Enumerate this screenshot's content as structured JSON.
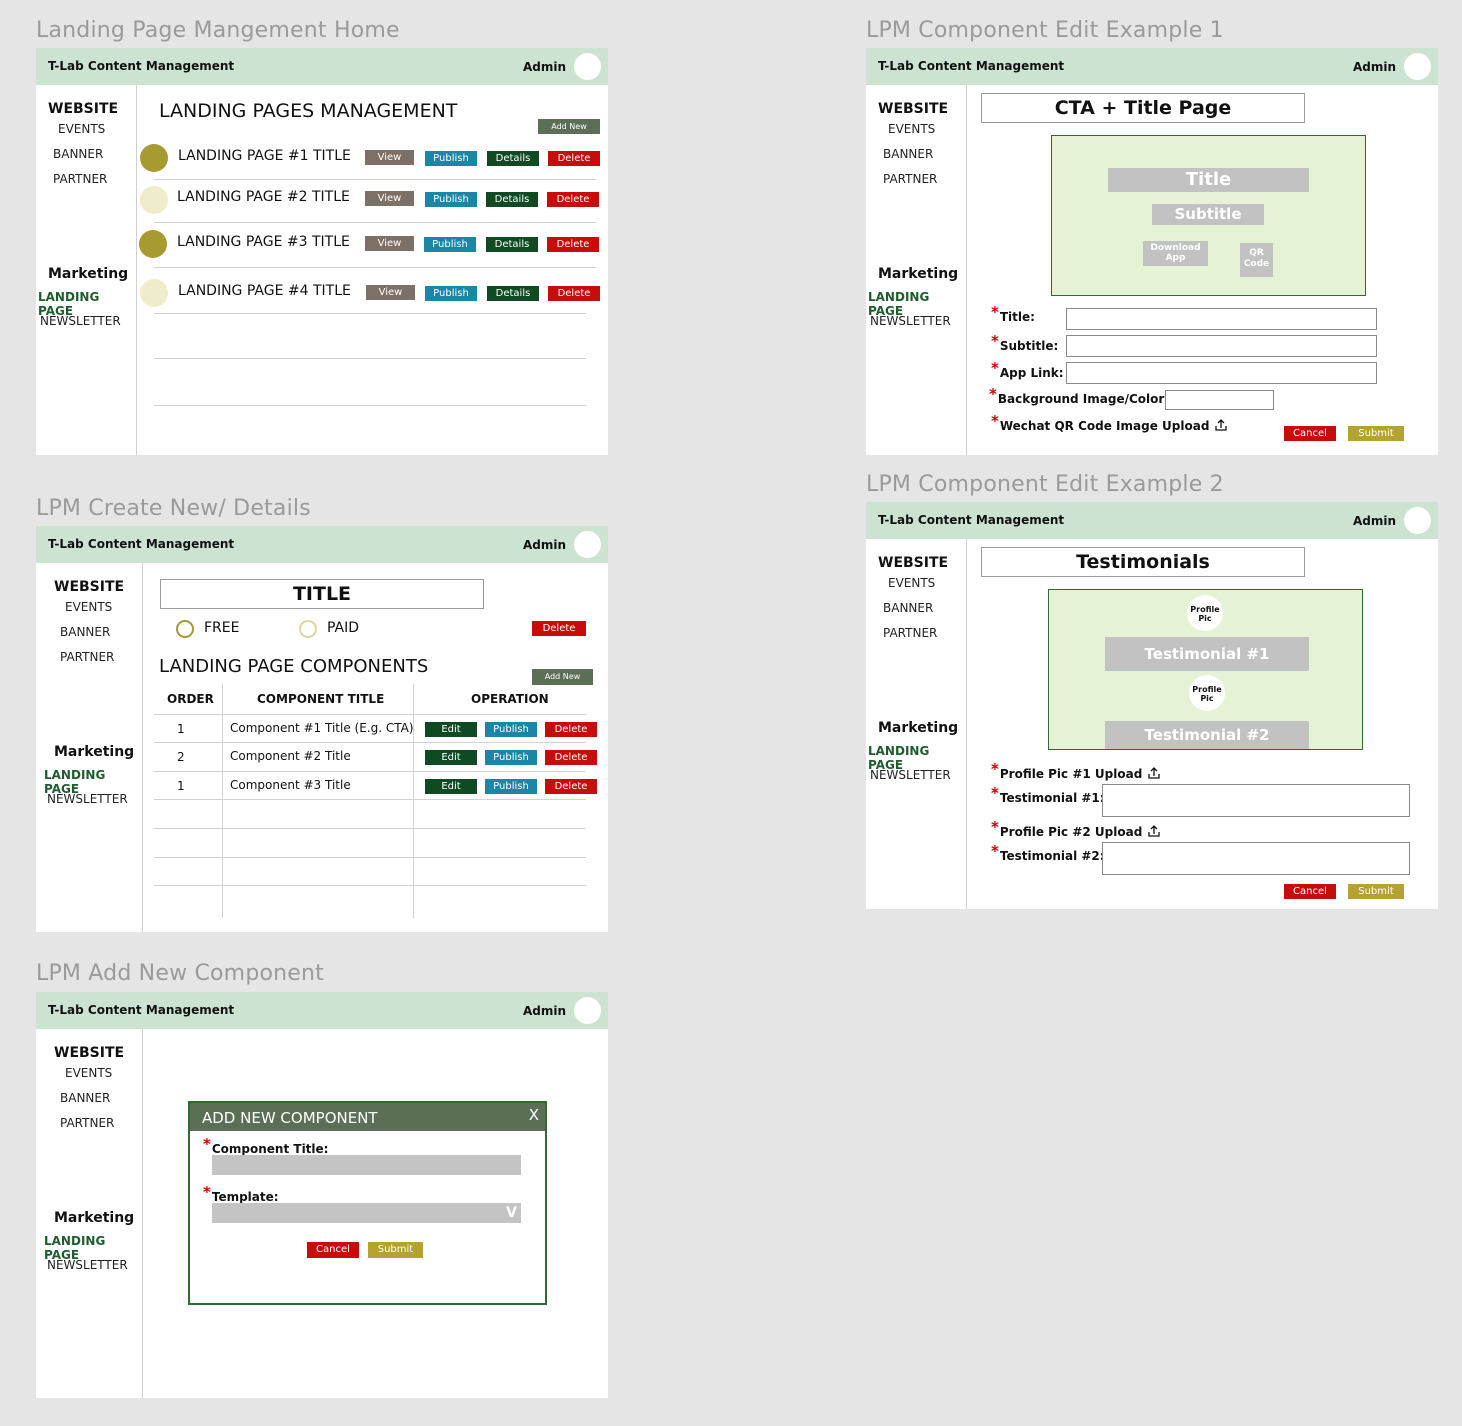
{
  "app": {
    "title": "T-Lab Content Management",
    "admin": "Admin"
  },
  "sidebar": {
    "website": "WEBSITE",
    "events": "EVENTS",
    "banner": "BANNER",
    "partner": "PARTNER",
    "marketing": "Marketing",
    "landing_page": "LANDING PAGE",
    "newsletter": "NEWSLETTER"
  },
  "frames": {
    "home": "Landing Page Mangement Home",
    "create": "LPM Create New/ Details",
    "add_component": "LPM Add New Component",
    "edit1": "LPM Component Edit Example 1",
    "edit2": "LPM Component Edit Example 2"
  },
  "home": {
    "heading": "LANDING PAGES MANAGEMENT",
    "add_new": "Add New",
    "buttons": {
      "view": "View",
      "publish": "Publish",
      "details": "Details",
      "delete": "Delete"
    },
    "pages": [
      {
        "title": "LANDING PAGE #1 TITLE",
        "status_color": "#a69a30"
      },
      {
        "title": "LANDING PAGE #2 TITLE",
        "status_color": "#efeccb"
      },
      {
        "title": "LANDING PAGE #3 TITLE",
        "status_color": "#a69a30"
      },
      {
        "title": "LANDING PAGE #4 TITLE",
        "status_color": "#efeccb"
      }
    ]
  },
  "create": {
    "title": "TITLE",
    "free": "FREE",
    "paid": "PAID",
    "delete": "Delete",
    "components_heading": "LANDING PAGE COMPONENTS",
    "add_new": "Add New",
    "columns": [
      "ORDER",
      "COMPONENT TITLE",
      "OPERATION"
    ],
    "buttons": {
      "edit": "Edit",
      "publish": "Publish",
      "delete": "Delete"
    },
    "rows": [
      {
        "order": "1",
        "title": "Component #1 Title (E.g. CTA)"
      },
      {
        "order": "2",
        "title": "Component #2 Title"
      },
      {
        "order": "1",
        "title": "Component #3 Title"
      }
    ]
  },
  "add_component": {
    "dialog_title": "ADD NEW COMPONENT",
    "close": "X",
    "component_title_label": "Component Title:",
    "template_label": "Template:",
    "dropdown_caret": "V",
    "cancel": "Cancel",
    "submit": "Submit"
  },
  "edit1": {
    "page_title": "CTA + Title Page",
    "preview": {
      "title": "Title",
      "subtitle": "Subtitle",
      "download": "Download App",
      "qr": "QR Code"
    },
    "fields": {
      "title": "Title:",
      "subtitle": "Subtitle:",
      "app_link": "App Link:",
      "background": "Background Image/Color",
      "qr_upload": "Wechat QR Code Image Upload"
    },
    "cancel": "Cancel",
    "submit": "Submit"
  },
  "edit2": {
    "page_title": "Testimonials",
    "preview": {
      "profile_pic": "Profile Pic",
      "testimonial1": "Testimonial #1",
      "testimonial2": "Testimonial #2"
    },
    "fields": {
      "pic1_upload": "Profile Pic #1 Upload",
      "testimonial1": "Testimonial #1:",
      "pic2_upload": "Profile Pic #2 Upload",
      "testimonial2": "Testimonial #2:"
    },
    "cancel": "Cancel",
    "submit": "Submit"
  },
  "colors": {
    "header_bg": "#cce3d2",
    "delete": "#c70c0c",
    "publish": "#1b86a6",
    "details": "#0f4a22",
    "view": "#7d7066",
    "submit": "#b4a331",
    "dialog_header": "#5a6f55"
  }
}
